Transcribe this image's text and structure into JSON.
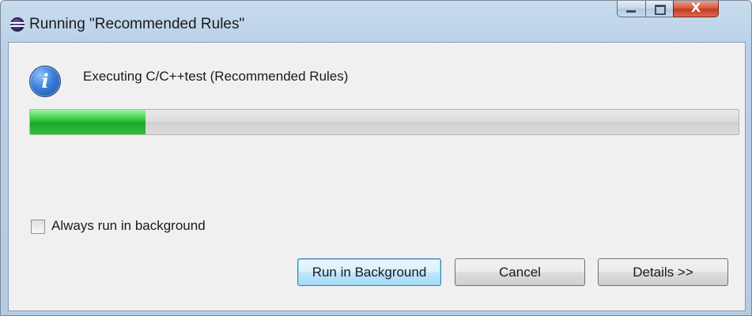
{
  "window": {
    "title": "Running \"Recommended Rules\"",
    "icon": "eclipse-icon",
    "controls": {
      "minimize": "minimize-icon",
      "maximize": "maximize-icon",
      "close": "X"
    }
  },
  "dialog": {
    "icon": "info-icon",
    "icon_glyph": "i",
    "message": "Executing C/C++test (Recommended Rules)",
    "progress": {
      "percent": 16.3,
      "color": "#22b634"
    },
    "checkbox": {
      "label": "Always run in background",
      "checked": false
    },
    "buttons": {
      "run_background": "Run in Background",
      "cancel": "Cancel",
      "details": "Details >>"
    }
  }
}
